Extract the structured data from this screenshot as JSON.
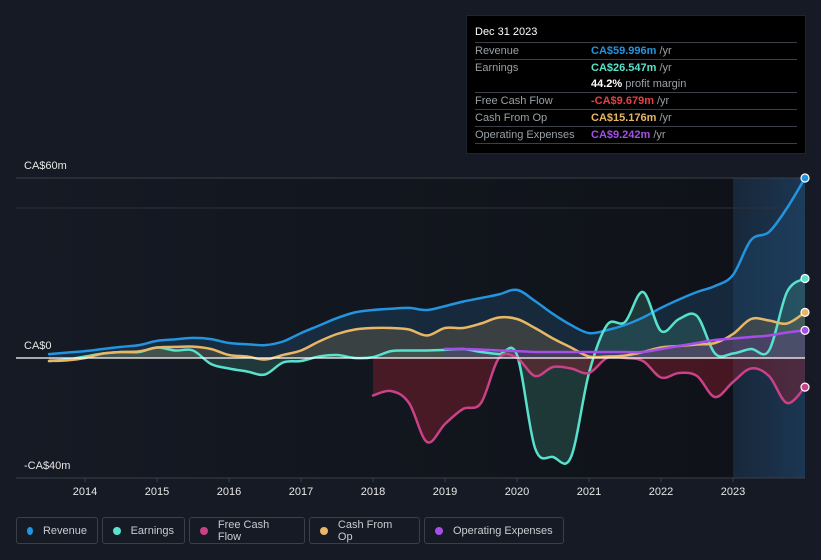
{
  "tooltip": {
    "date": "Dec 31 2023",
    "rows": [
      {
        "label": "Revenue",
        "value": "CA$59.996m",
        "unit": "/yr",
        "color": "#2394df"
      },
      {
        "label": "Earnings",
        "value": "CA$26.547m",
        "unit": "/yr",
        "color": "#58e1cd"
      },
      {
        "label": "",
        "value": "44.2%",
        "unit": "profit margin",
        "color": "#ffffff"
      },
      {
        "label": "Free Cash Flow",
        "value": "-CA$9.679m",
        "unit": "/yr",
        "color": "#e84040"
      },
      {
        "label": "Cash From Op",
        "value": "CA$15.176m",
        "unit": "/yr",
        "color": "#e8b766"
      },
      {
        "label": "Operating Expenses",
        "value": "CA$9.242m",
        "unit": "/yr",
        "color": "#a64ee8"
      }
    ]
  },
  "legend": [
    {
      "label": "Revenue",
      "color": "#2394df"
    },
    {
      "label": "Earnings",
      "color": "#58e1cd"
    },
    {
      "label": "Free Cash Flow",
      "color": "#c94187"
    },
    {
      "label": "Cash From Op",
      "color": "#e8b766"
    },
    {
      "label": "Operating Expenses",
      "color": "#a64ee8"
    }
  ],
  "chart_data": {
    "type": "area",
    "title": "",
    "xlabel": "",
    "ylabel": "",
    "y_tick_labels": [
      "CA$60m",
      "CA$0",
      "-CA$40m"
    ],
    "ylim": [
      -40,
      60
    ],
    "xlim": [
      2013.5,
      2024.0
    ],
    "x_ticks": [
      "2014",
      "2015",
      "2016",
      "2017",
      "2018",
      "2019",
      "2020",
      "2021",
      "2022",
      "2023"
    ],
    "x_tick_values": [
      2014,
      2015,
      2016,
      2017,
      2018,
      2019,
      2020,
      2021,
      2022,
      2023
    ],
    "grid": true,
    "highlight_from": 2023.0,
    "series": [
      {
        "name": "Revenue",
        "color": "#2394df",
        "x": [
          2013.5,
          2013.75,
          2014,
          2014.25,
          2014.5,
          2014.75,
          2015,
          2015.25,
          2015.5,
          2015.75,
          2016,
          2016.25,
          2016.5,
          2016.75,
          2017,
          2017.25,
          2017.5,
          2017.75,
          2018,
          2018.25,
          2018.5,
          2018.75,
          2019,
          2019.25,
          2019.5,
          2019.75,
          2020,
          2020.25,
          2020.5,
          2020.75,
          2021,
          2021.25,
          2021.5,
          2021.75,
          2022,
          2022.25,
          2022.5,
          2022.75,
          2023,
          2023.25,
          2023.5,
          2023.75,
          2024
        ],
        "values": [
          1.3,
          1.8,
          2.3,
          3.0,
          3.7,
          4.3,
          5.7,
          6.2,
          6.7,
          6.3,
          5.0,
          4.6,
          4.3,
          5.5,
          8.3,
          10.8,
          13.3,
          15.2,
          16.0,
          16.4,
          16.7,
          16.0,
          17.3,
          18.8,
          20.0,
          21.2,
          22.7,
          19.0,
          14.7,
          11.0,
          8.3,
          9.3,
          11.0,
          13.5,
          16.7,
          19.5,
          22.0,
          24.0,
          27.7,
          39.3,
          42.0,
          50.0,
          60.0
        ]
      },
      {
        "name": "Earnings",
        "color": "#58e1cd",
        "x": [
          2013.5,
          2013.75,
          2014,
          2014.25,
          2014.5,
          2014.75,
          2015,
          2015.25,
          2015.5,
          2015.75,
          2016,
          2016.25,
          2016.5,
          2016.75,
          2017,
          2017.25,
          2017.5,
          2017.75,
          2018,
          2018.25,
          2018.5,
          2018.75,
          2019,
          2019.25,
          2019.5,
          2019.75,
          2020,
          2020.25,
          2020.5,
          2020.75,
          2021,
          2021.25,
          2021.5,
          2021.75,
          2022,
          2022.25,
          2022.5,
          2022.75,
          2023,
          2023.25,
          2023.5,
          2023.75,
          2024
        ],
        "values": [
          -1.0,
          -0.5,
          0.5,
          1.5,
          2.0,
          2.0,
          3.5,
          2.5,
          2.5,
          -2.0,
          -3.5,
          -4.5,
          -5.5,
          -1.5,
          -1.0,
          0.5,
          1.0,
          0.0,
          0.3,
          2.3,
          2.5,
          2.5,
          2.7,
          3.0,
          2.0,
          1.3,
          1.0,
          -30.0,
          -33.0,
          -33.0,
          -5.0,
          11.0,
          12.0,
          22.0,
          9.0,
          13.0,
          14.0,
          1.5,
          1.5,
          3.0,
          2.5,
          22.0,
          26.5
        ]
      },
      {
        "name": "Free Cash Flow",
        "color": "#c94187",
        "x": [
          2018,
          2018.25,
          2018.5,
          2018.75,
          2019,
          2019.25,
          2019.5,
          2019.75,
          2020,
          2020.25,
          2020.5,
          2020.75,
          2021,
          2021.25,
          2021.5,
          2021.75,
          2022,
          2022.25,
          2022.5,
          2022.75,
          2023,
          2023.25,
          2023.5,
          2023.75,
          2024
        ],
        "values": [
          -12.5,
          -11.0,
          -15.0,
          -28.0,
          -22.0,
          -17.0,
          -15.0,
          0.0,
          0.0,
          -6.0,
          -3.0,
          -3.5,
          -5.0,
          0.0,
          0.0,
          -1.0,
          -6.5,
          -5.0,
          -6.0,
          -13.0,
          -8.0,
          -3.5,
          -6.0,
          -15.0,
          -9.7
        ]
      },
      {
        "name": "Cash From Op",
        "color": "#e8b766",
        "x": [
          2013.5,
          2013.75,
          2014,
          2014.25,
          2014.5,
          2014.75,
          2015,
          2015.25,
          2015.5,
          2015.75,
          2016,
          2016.25,
          2016.5,
          2016.75,
          2017,
          2017.25,
          2017.5,
          2017.75,
          2018,
          2018.25,
          2018.5,
          2018.75,
          2019,
          2019.25,
          2019.5,
          2019.75,
          2020,
          2020.25,
          2020.5,
          2020.75,
          2021,
          2021.25,
          2021.5,
          2021.75,
          2022,
          2022.25,
          2022.5,
          2022.75,
          2023,
          2023.25,
          2023.5,
          2023.75,
          2024
        ],
        "values": [
          -1.0,
          -0.8,
          0.0,
          1.5,
          2.0,
          2.2,
          3.5,
          3.7,
          3.8,
          3.0,
          1.0,
          0.5,
          -0.5,
          1.0,
          2.5,
          5.5,
          8.0,
          9.5,
          10.0,
          10.0,
          9.5,
          7.5,
          10.0,
          10.0,
          11.5,
          13.5,
          13.0,
          10.0,
          6.5,
          3.5,
          0.5,
          0.5,
          0.8,
          2.0,
          3.5,
          4.0,
          4.5,
          5.0,
          8.0,
          13.0,
          12.5,
          11.5,
          15.2
        ]
      },
      {
        "name": "Operating Expenses",
        "color": "#a64ee8",
        "x": [
          2019,
          2019.25,
          2019.5,
          2019.75,
          2020,
          2020.25,
          2020.5,
          2020.75,
          2021,
          2021.25,
          2021.5,
          2021.75,
          2022,
          2022.25,
          2022.5,
          2022.75,
          2023,
          2023.25,
          2023.5,
          2023.75,
          2024
        ],
        "values": [
          3.0,
          3.0,
          2.8,
          2.5,
          2.3,
          2.0,
          2.0,
          2.0,
          2.0,
          2.0,
          2.0,
          2.0,
          3.0,
          4.0,
          5.0,
          6.0,
          6.5,
          7.0,
          7.5,
          8.5,
          9.2
        ]
      }
    ]
  }
}
